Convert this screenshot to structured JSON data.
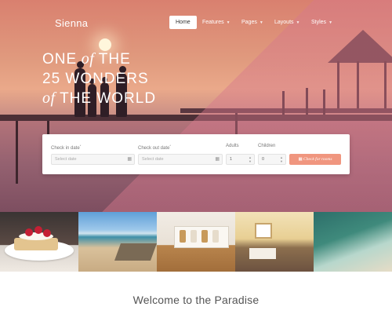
{
  "site": {
    "logo": "Sienna"
  },
  "nav": {
    "items": [
      {
        "label": "Home",
        "active": true
      },
      {
        "label": "Features",
        "dropdown": true
      },
      {
        "label": "Pages",
        "dropdown": true
      },
      {
        "label": "Layouts",
        "dropdown": true
      },
      {
        "label": "Styles",
        "dropdown": true
      }
    ]
  },
  "hero": {
    "line1_a": "ONE",
    "line1_b": "of",
    "line1_c": "THE",
    "line2": "25 WONDERS",
    "line3_a": "of",
    "line3_b": "THE WORLD"
  },
  "booking": {
    "checkin_label": "Check in date",
    "checkout_label": "Check out date",
    "required_mark": "*",
    "checkin_placeholder": "Select date",
    "checkout_placeholder": "Select date",
    "adults_label": "Adults",
    "children_label": "Children",
    "adults_value": "1",
    "children_value": "0",
    "submit_label": "Check for rooms"
  },
  "gallery": {
    "items": [
      {
        "icon": "dessert-photo"
      },
      {
        "icon": "beach-boat-photo"
      },
      {
        "icon": "kitchen-shelf-photo"
      },
      {
        "icon": "hotel-room-photo"
      },
      {
        "icon": "aerial-coast-photo"
      }
    ]
  },
  "welcome": {
    "title": "Welcome to the Paradise"
  },
  "colors": {
    "accent": "#f0967f",
    "nav_active_bg": "#ffffff"
  }
}
